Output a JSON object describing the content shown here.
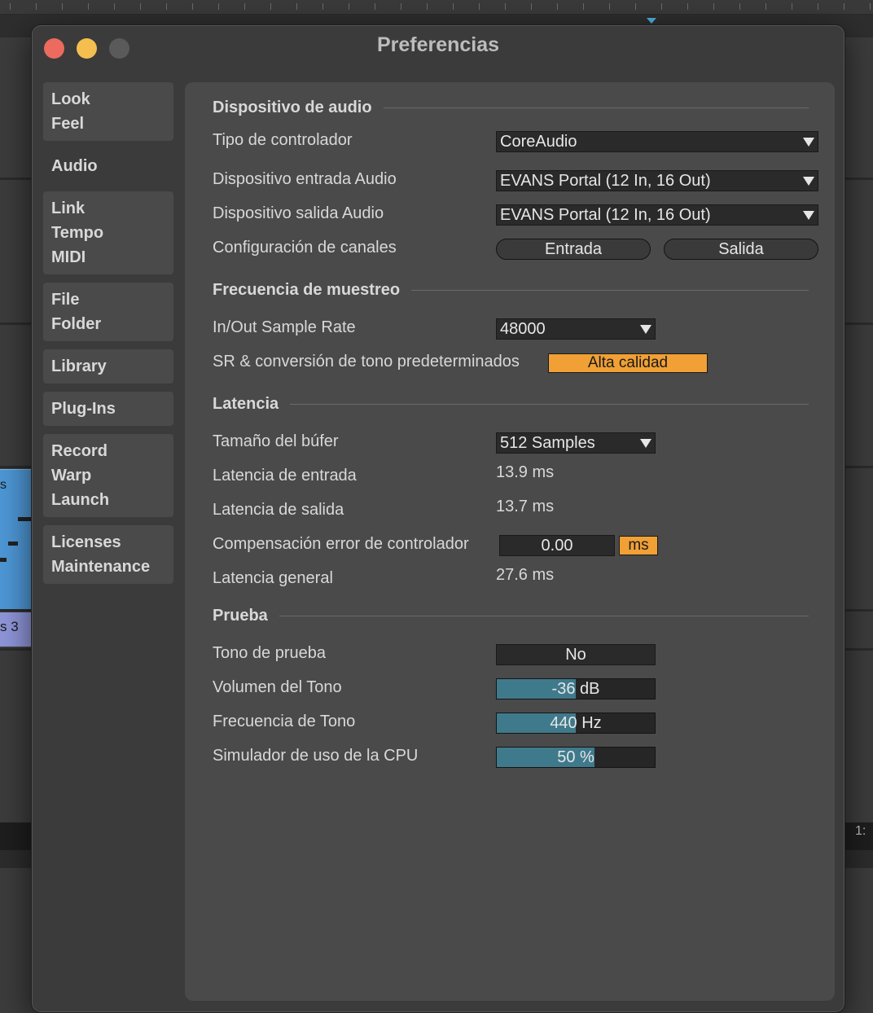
{
  "window": {
    "title": "Preferencias"
  },
  "sidebar": {
    "tabs": [
      {
        "lines": [
          "Look",
          "Feel"
        ]
      },
      {
        "lines": [
          "Audio"
        ],
        "active": true
      },
      {
        "lines": [
          "Link",
          "Tempo",
          "MIDI"
        ]
      },
      {
        "lines": [
          "File",
          "Folder"
        ]
      },
      {
        "lines": [
          "Library"
        ]
      },
      {
        "lines": [
          "Plug-Ins"
        ]
      },
      {
        "lines": [
          "Record",
          "Warp",
          "Launch"
        ]
      },
      {
        "lines": [
          "Licenses",
          "Maintenance"
        ]
      }
    ]
  },
  "audio_device": {
    "heading": "Dispositivo de audio",
    "driver_type": {
      "label": "Tipo de controlador",
      "value": "CoreAudio"
    },
    "input_device": {
      "label": "Dispositivo entrada Audio",
      "value": "EVANS Portal (12 In, 16 Out)"
    },
    "output_device": {
      "label": "Dispositivo salida Audio",
      "value": "EVANS Portal (12 In, 16 Out)"
    },
    "channel_config": {
      "label": "Configuración de canales",
      "input_button": "Entrada",
      "output_button": "Salida"
    }
  },
  "sample_rate": {
    "heading": "Frecuencia de muestreo",
    "in_out_rate": {
      "label": "In/Out Sample Rate",
      "value": "48000"
    },
    "conversion": {
      "label": "SR & conversión de tono predeterminados",
      "value": "Alta calidad"
    }
  },
  "latency": {
    "heading": "Latencia",
    "buffer_size": {
      "label": "Tamaño del búfer",
      "value": "512 Samples"
    },
    "input_latency": {
      "label": "Latencia de entrada",
      "value": "13.9 ms"
    },
    "output_latency": {
      "label": "Latencia de salida",
      "value": "13.7 ms"
    },
    "driver_error": {
      "label": "Compensación error de controlador",
      "value": "0.00",
      "unit": "ms"
    },
    "overall_latency": {
      "label": "Latencia general",
      "value": "27.6 ms"
    }
  },
  "test": {
    "heading": "Prueba",
    "test_tone": {
      "label": "Tono de prueba",
      "value": "No"
    },
    "tone_volume": {
      "label": "Volumen del Tono",
      "value": "-36 dB",
      "fill": 0.5
    },
    "tone_frequency": {
      "label": "Frecuencia de Tono",
      "value": "440 Hz",
      "fill": 0.5
    },
    "cpu_simulator": {
      "label": "Simulador de uso de la CPU",
      "value": "50 %",
      "fill": 0.62
    }
  },
  "background": {
    "clip_label": "s 3",
    "clip_top_label": "s",
    "corner_label": "1:"
  },
  "colors": {
    "accent_orange": "#f0a035",
    "slider_fill": "#3f7a8c",
    "clip_blue": "#4e97d6",
    "clip_lavender": "#8f96d9"
  }
}
